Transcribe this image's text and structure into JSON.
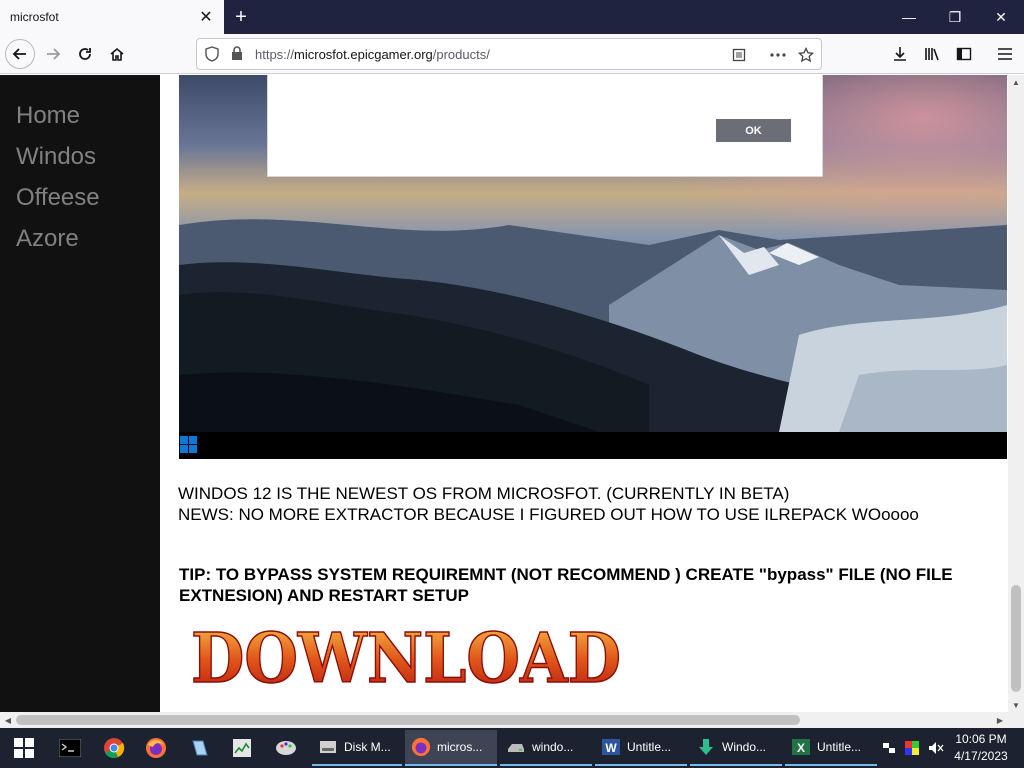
{
  "browser": {
    "tab_title": "microsfot",
    "tab_close": "✕",
    "new_tab": "+",
    "url_scheme": "https://",
    "url_domain": "microsfot.epicgamer.org",
    "url_path": "/products/",
    "minimize": "—",
    "restore": "❐",
    "close": "✕"
  },
  "sidebar": {
    "items": [
      {
        "label": "Home"
      },
      {
        "label": "Windos"
      },
      {
        "label": "Offeese"
      },
      {
        "label": "Azore"
      }
    ]
  },
  "dialog": {
    "ok_label": "OK"
  },
  "content": {
    "line1": "WINDOS 12 IS THE NEWEST OS FROM MICROSFOT. (CURRENTLY IN BETA)",
    "line2": "NEWS: NO MORE EXTRACTOR BECAUSE I FIGURED OUT HOW TO USE ILREPACK WOoooo",
    "tip": "TIP: TO BYPASS SYSTEM REQUIREMNT (NOT RECOMMEND ) CREATE \"bypass\" FILE (NO FILE EXTNESION) AND RESTART SETUP",
    "download_label": "DOWNLOAD"
  },
  "taskbar": {
    "tasks": [
      {
        "label": "Disk M...",
        "icon": "disk-management-icon"
      },
      {
        "label": "micros...",
        "icon": "firefox-icon"
      },
      {
        "label": "windo...",
        "icon": "drive-icon"
      },
      {
        "label": "Untitle...",
        "icon": "word-icon"
      },
      {
        "label": "Windo...",
        "icon": "installer-icon"
      },
      {
        "label": "Untitle...",
        "icon": "excel-icon"
      }
    ],
    "time": "10:06 PM",
    "date": "4/17/2023"
  },
  "colors": {
    "accent": "#0a7ad6",
    "sidebar_bg": "#111111",
    "sidebar_link": "#818181",
    "titlebar": "#202340",
    "taskbar": "#1c2230"
  }
}
